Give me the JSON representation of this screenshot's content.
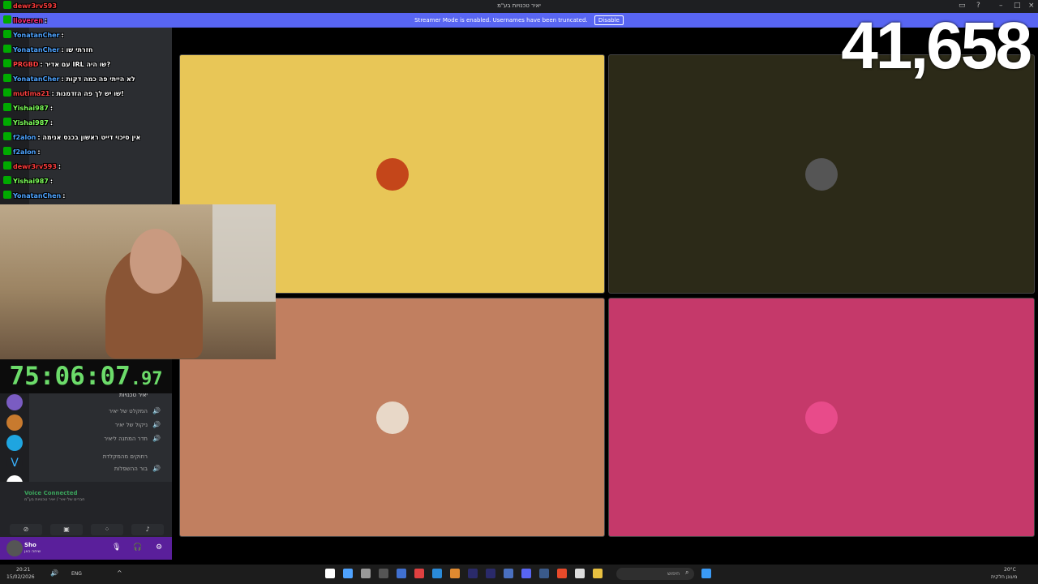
{
  "window": {
    "title": "יאיר טכנויות בע\"מ"
  },
  "banner": {
    "text": "Streamer Mode is enabled. Usernames have been truncated.",
    "disable_label": "Disable"
  },
  "counter": "41,658",
  "timer": {
    "main": "75:06:07",
    "ms": ".97"
  },
  "chat": [
    {
      "user": "dewr3rv593",
      "text": "",
      "color": "#ff3b3b"
    },
    {
      "user": "Iloveren",
      "text": ":",
      "color": "#ff2a7a"
    },
    {
      "user": "YonatanCher",
      "text": ":",
      "color": "#4da3ff"
    },
    {
      "user": "YonatanCher",
      "text": ": חזרתי שו",
      "color": "#4da3ff"
    },
    {
      "user": "PRGBD",
      "text": ": עם אדיר IRL שו היה?",
      "color": "#ff4040"
    },
    {
      "user": "YonatanCher",
      "text": ": לא הייתי פה כמה דקות",
      "color": "#4da3ff"
    },
    {
      "user": "mutima21",
      "text": ": שו יש לך פה הזדמנות!",
      "color": "#ff4040"
    },
    {
      "user": "Yishai987",
      "text": ":",
      "color": "#7dff5a"
    },
    {
      "user": "Yishai987",
      "text": ":",
      "color": "#7dff5a"
    },
    {
      "user": "f2alon",
      "text": ": אין סיכוי דייט ראשון בכנס אנימה",
      "color": "#4da3ff"
    },
    {
      "user": "f2alon",
      "text": ":",
      "color": "#4da3ff"
    },
    {
      "user": "dewr3rv593",
      "text": ":",
      "color": "#ff3b3b"
    },
    {
      "user": "Yishai987",
      "text": ":",
      "color": "#7dff5a"
    },
    {
      "user": "YonatanChen",
      "text": ":",
      "color": "#4da3ff"
    }
  ],
  "channels": [
    {
      "label": "יאיר טכנויות"
    },
    {
      "label": "המקלט של יאיר"
    },
    {
      "label": "ניקול של יאיר"
    },
    {
      "label": "חדר המתנה ליאיר"
    },
    {
      "label": "רחוקים מהמקלדת"
    },
    {
      "label": "בור ההשפלות"
    }
  ],
  "voice": {
    "status": "Voice Connected",
    "channel": "חברים של יאיר / יאיר טכנויות בע\"מ"
  },
  "user": {
    "name": "Sho",
    "status": "שיחה כאן"
  },
  "tiles": [
    {
      "color": "#e8c657",
      "avatar": "#c4461a"
    },
    {
      "color": "#2c2a18",
      "avatar": "#555"
    },
    {
      "color": "#c17f60",
      "avatar": "#e8d8c8"
    },
    {
      "color": "#c5396a",
      "avatar": "#e84b8a"
    }
  ],
  "taskbar": {
    "search_placeholder": "חיפוש",
    "temp": "20°C",
    "weather": "מעונן חלקית",
    "time": "20:21",
    "date": "15/02/2026",
    "lang": "ENG"
  }
}
